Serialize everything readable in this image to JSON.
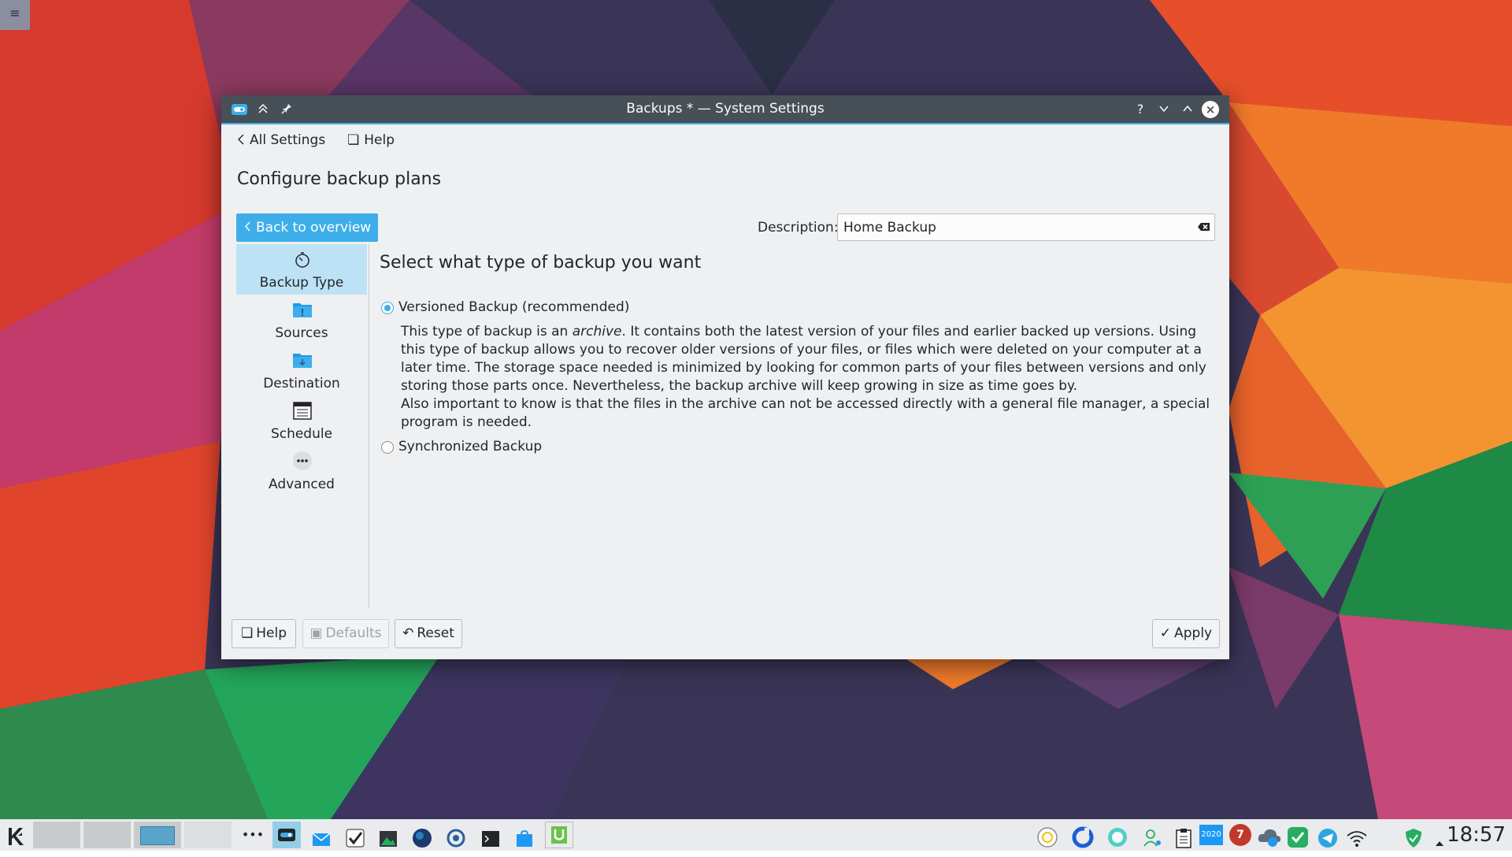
{
  "window": {
    "title": "Backups * — System Settings",
    "help_symbol": "?"
  },
  "topnav": {
    "all_settings": "All Settings",
    "help": "Help"
  },
  "page_title": "Configure backup plans",
  "back_button": "Back to overview",
  "description": {
    "label": "Description:",
    "value": "Home Backup"
  },
  "sidebar": {
    "items": [
      {
        "label": "Backup Type",
        "icon": "clock-icon",
        "active": true
      },
      {
        "label": "Sources",
        "icon": "folder-important-icon",
        "active": false
      },
      {
        "label": "Destination",
        "icon": "folder-download-icon",
        "active": false
      },
      {
        "label": "Schedule",
        "icon": "calendar-icon",
        "active": false
      },
      {
        "label": "Advanced",
        "icon": "more-icon",
        "active": false
      }
    ]
  },
  "main": {
    "title": "Select what type of backup you want",
    "option_versioned": "Versioned Backup (recommended)",
    "option_versioned_checked": true,
    "description_part1": "This type of backup is an ",
    "description_em": "archive",
    "description_part2": ". It contains both the latest version of your files and earlier backed up versions. Using this type of backup allows you to recover older versions of your files, or files which were deleted on your computer at a later time. The storage space needed is minimized by looking for common parts of your files between versions and only storing those parts once. Nevertheless, the backup archive will keep growing in size as time goes by.",
    "description_line2": "Also important to know is that the files in the archive can not be accessed directly with a general file manager, a special program is needed.",
    "option_synchronized": "Synchronized Backup",
    "option_synchronized_checked": false
  },
  "footer": {
    "help": "Help",
    "defaults": "Defaults",
    "reset": "Reset",
    "apply": "Apply"
  },
  "taskbar": {
    "clock": "18:57",
    "tray_calendar_text": "2020",
    "tray_badge": "7"
  },
  "colors": {
    "accent": "#3daee9",
    "titlebar": "#475057",
    "window_bg": "#eff0f1",
    "selection": "#bde2f6"
  }
}
